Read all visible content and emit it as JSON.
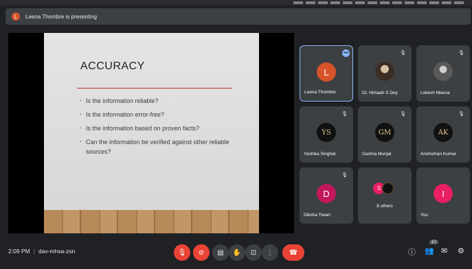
{
  "presenter_banner": {
    "avatar_letter": "L",
    "text": "Leena Thombre is presenting"
  },
  "slide": {
    "title": "ACCURACY",
    "bullets": [
      "Is the information reliable?",
      "Is the information error-free?",
      "Is the information based on proven facts?",
      "Can the information be verified against other reliable sources?"
    ]
  },
  "participants": [
    {
      "name": "Leena Thombre",
      "avatar": "L",
      "color": "#d8532a",
      "active": true
    },
    {
      "name": "Dr. Himadri S Dey",
      "avatar": ""
    },
    {
      "name": "Lokesh Meena",
      "avatar": ""
    },
    {
      "name": "Yashika Singhal",
      "avatar": "YS"
    },
    {
      "name": "Garima Munjal",
      "avatar": "GM"
    },
    {
      "name": "Anshuman Kumar",
      "avatar": "AK"
    },
    {
      "name": "Diksha Tiwari",
      "avatar": "D",
      "color": "#c2185b"
    },
    {
      "name": "8 others",
      "avatar_a": "S",
      "avatar_b": ""
    },
    {
      "name": "You",
      "avatar": "I",
      "color": "#e91e63"
    }
  ],
  "bottom_bar": {
    "time": "2:09 PM",
    "meeting_code": "dav-mhsa-zsn",
    "participant_count_badge": "17"
  },
  "icons": {
    "mic": "mic-off-icon",
    "camera": "camera-off-icon",
    "captions": "captions-icon",
    "hand": "raise-hand-icon",
    "present": "present-icon",
    "more": "more-vert-icon",
    "end": "end-call-icon",
    "info": "info-icon",
    "people": "people-icon",
    "chat": "chat-icon",
    "activities": "activities-icon"
  }
}
